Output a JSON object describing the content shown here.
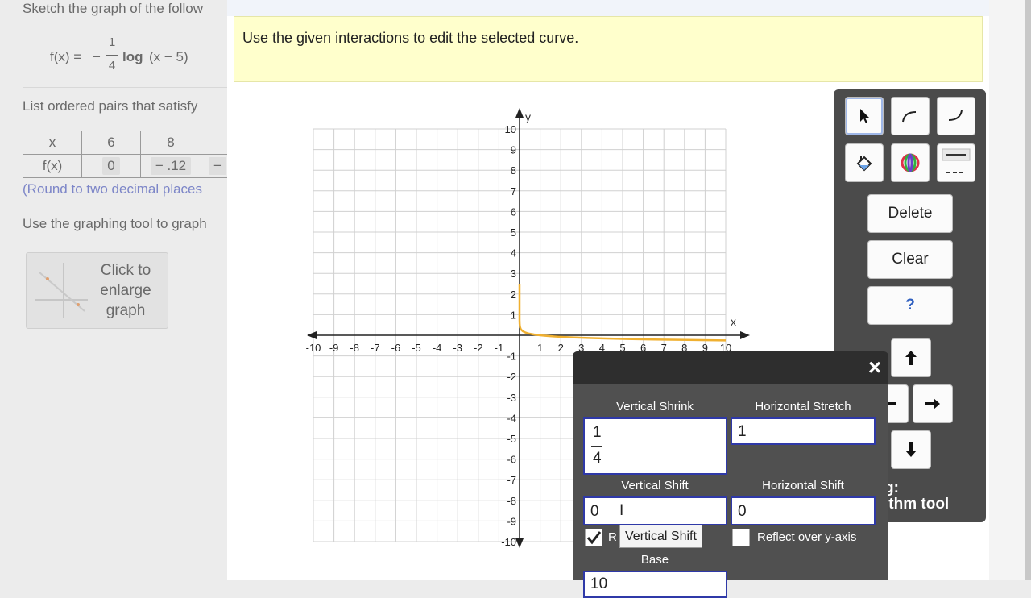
{
  "question": {
    "prompt_line": "Sketch the graph of the follow",
    "function": {
      "lhs": "f(x) =",
      "sign": "−",
      "coef_num": "1",
      "coef_den": "4",
      "log": "log",
      "arg": "(x − 5)"
    },
    "table_prompt": "List ordered pairs that satisfy",
    "table": {
      "row_x": {
        "label": "x",
        "values": [
          "6",
          "8",
          ""
        ]
      },
      "row_fx": {
        "label": "f(x)",
        "values": [
          "0",
          "− .12",
          "−"
        ]
      }
    },
    "round_note": "(Round to two decimal places",
    "graph_prompt": "Use the graphing tool to graph",
    "enlarge": {
      "line1": "Click to",
      "line2": "enlarge",
      "line3": "graph"
    }
  },
  "instruction": "Use the given interactions to edit the selected curve.",
  "graph": {
    "x_axis_label": "x",
    "y_axis_label": "y",
    "x_ticks": [
      "-10",
      "-9",
      "-8",
      "-7",
      "-6",
      "-5",
      "-4",
      "-3",
      "-2",
      "-1",
      "1",
      "2",
      "3",
      "4",
      "5",
      "6",
      "7",
      "8",
      "9",
      "10"
    ],
    "y_ticks": [
      "10",
      "9",
      "8",
      "7",
      "6",
      "5",
      "4",
      "3",
      "2",
      "1",
      "-1",
      "-2",
      "-3",
      "-4",
      "-5",
      "-6",
      "-7",
      "-8",
      "-9",
      "-10"
    ],
    "xlim": [
      -10,
      10
    ],
    "ylim": [
      -10,
      10
    ],
    "curve_color": "#f0b030"
  },
  "toolbar": {
    "tools": [
      {
        "name": "select-pointer-icon",
        "selected": true
      },
      {
        "name": "curve-up-icon"
      },
      {
        "name": "curve-down-icon"
      },
      {
        "name": "paint-bucket-icon"
      },
      {
        "name": "color-wheel-icon"
      },
      {
        "name": "line-style-icon"
      }
    ],
    "delete_label": "Delete",
    "clear_label": "Clear",
    "help_label": "?",
    "hint": {
      "line1": "g:",
      "line2": "ithm tool"
    }
  },
  "dialog": {
    "close_label": "×",
    "vertical_shrink_label": "Vertical Shrink",
    "vertical_shrink_num": "1",
    "vertical_shrink_den": "4",
    "horizontal_stretch_label": "Horizontal Stretch",
    "horizontal_stretch_value": "1",
    "vertical_shift_label": "Vertical Shift",
    "vertical_shift_value": "0",
    "horizontal_shift_label": "Horizontal Shift",
    "horizontal_shift_value": "0",
    "reflect_x_label": "R",
    "reflect_x_checked": true,
    "reflect_y_label": "Reflect over y-axis",
    "reflect_y_checked": false,
    "base_label": "Base",
    "base_value": "10"
  },
  "tooltip": "Vertical Shift"
}
